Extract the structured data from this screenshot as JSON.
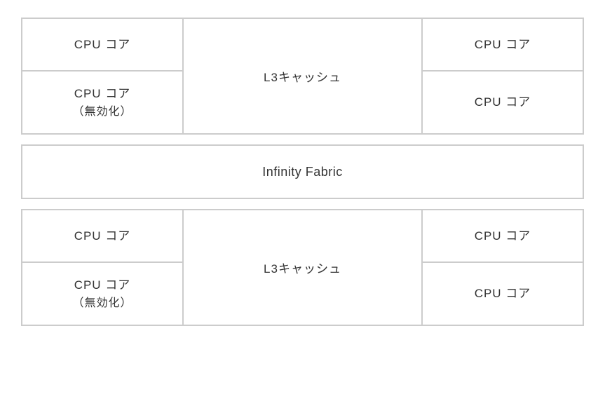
{
  "ccx_top": {
    "core_top_left": {
      "label": "CPU コア",
      "subtext": ""
    },
    "core_bottom_left": {
      "label": "CPU コア",
      "subtext": "（無効化）"
    },
    "l3_label": "L3キャッシュ",
    "core_top_right": {
      "label": "CPU コア",
      "subtext": ""
    },
    "core_bottom_right": {
      "label": "CPU コア",
      "subtext": ""
    }
  },
  "fabric_label": "Infinity Fabric",
  "ccx_bottom": {
    "core_top_left": {
      "label": "CPU コア",
      "subtext": ""
    },
    "core_bottom_left": {
      "label": "CPU コア",
      "subtext": "（無効化）"
    },
    "l3_label": "L3キャッシュ",
    "core_top_right": {
      "label": "CPU コア",
      "subtext": ""
    },
    "core_bottom_right": {
      "label": "CPU コア",
      "subtext": ""
    }
  }
}
